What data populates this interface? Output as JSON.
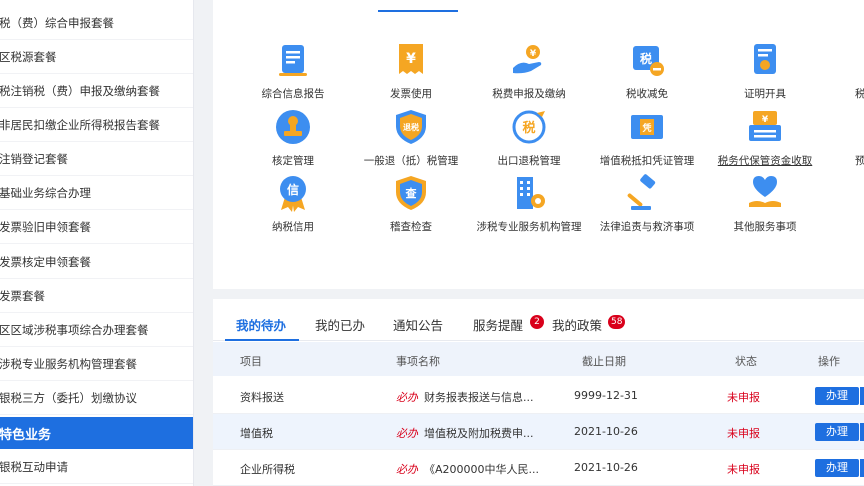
{
  "sidebar": {
    "items": [
      {
        "label": "税（费）综合申报套餐"
      },
      {
        "label": "区税源套餐"
      },
      {
        "label": "税注销税（费）申报及缴纳套餐"
      },
      {
        "label": "非居民扣缴企业所得税报告套餐"
      },
      {
        "label": "注销登记套餐"
      },
      {
        "label": "基础业务综合办理"
      },
      {
        "label": "发票验旧申领套餐"
      },
      {
        "label": "发票核定申领套餐"
      },
      {
        "label": "发票套餐"
      },
      {
        "label": "区区域涉税事项综合办理套餐"
      },
      {
        "label": "涉税专业服务机构管理套餐"
      },
      {
        "label": "银税三方（委托）划缴协议"
      },
      {
        "label": "特色业务"
      },
      {
        "label": "银税互动申请"
      }
    ],
    "active_index": 12
  },
  "services": [
    {
      "label": "综合信息报告",
      "icon": "document-report-icon"
    },
    {
      "label": "发票使用",
      "icon": "invoice-yen-icon"
    },
    {
      "label": "税费申报及缴纳",
      "icon": "hand-coin-icon"
    },
    {
      "label": "税收减免",
      "icon": "tax-reduction-icon"
    },
    {
      "label": "证明开具",
      "icon": "certificate-icon"
    },
    {
      "label": "税",
      "icon": "truncated-icon"
    },
    {
      "label": "核定管理",
      "icon": "stamp-icon"
    },
    {
      "label": "一般退（抵）税管理",
      "icon": "refund-shield-icon"
    },
    {
      "label": "出口退税管理",
      "icon": "export-refund-icon"
    },
    {
      "label": "增值税抵扣凭证管理",
      "icon": "voucher-icon"
    },
    {
      "label": "税务代保管资金收取",
      "icon": "cash-register-icon"
    },
    {
      "label": "预",
      "icon": "truncated-icon"
    },
    {
      "label": "纳税信用",
      "icon": "credit-medal-icon"
    },
    {
      "label": "稽查检查",
      "icon": "inspection-shield-icon"
    },
    {
      "label": "涉税专业服务机构管理",
      "icon": "building-gear-icon"
    },
    {
      "label": "法律追责与救济事项",
      "icon": "gavel-icon"
    },
    {
      "label": "其他服务事项",
      "icon": "heart-hand-icon"
    }
  ],
  "tabs": [
    {
      "label": "我的待办"
    },
    {
      "label": "我的已办"
    },
    {
      "label": "通知公告"
    },
    {
      "label": "服务提醒",
      "badge": "2"
    },
    {
      "label": "我的政策",
      "badge": "58"
    }
  ],
  "table": {
    "headers": [
      "项目",
      "事项名称",
      "截止日期",
      "状态",
      "操作"
    ],
    "rows": [
      {
        "item": "资料报送",
        "must": "必办",
        "name": "财务报表报送与信息...",
        "date": "9999-12-31",
        "status": "未申报",
        "action": "办理"
      },
      {
        "item": "增值税",
        "must": "必办",
        "name": "增值税及附加税费申...",
        "date": "2021-10-26",
        "status": "未申报",
        "action": "办理"
      },
      {
        "item": "企业所得税",
        "must": "必办",
        "name": "《A200000中华人民...",
        "date": "2021-10-26",
        "status": "未申报",
        "action": "办理"
      }
    ]
  },
  "colors": {
    "accent": "#1e6fe0",
    "danger": "#d9001b",
    "icon_orange": "#f5a623",
    "icon_blue": "#3d8ef0"
  }
}
